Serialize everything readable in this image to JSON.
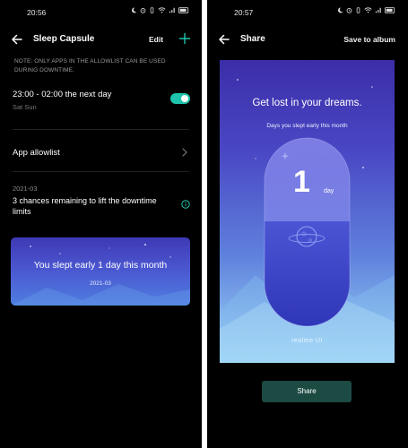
{
  "left_screen": {
    "status_time": "20:56",
    "title": "Sleep Capsule",
    "edit_label": "Edit",
    "notice": "NOTE: ONLY APPS IN THE ALLOWLIST CAN BE USED DURING DOWNTIME.",
    "schedule_time": "23:00 - 02:00 the next day",
    "schedule_days": "Sat Sun",
    "toggle_on": true,
    "allowlist_label": "App allowlist",
    "month": "2021-03",
    "chances_text": "3 chances remaining to lift the downtime limits",
    "summary_text": "You slept early 1 day this month",
    "summary_date": "2021-03"
  },
  "right_screen": {
    "status_time": "20:57",
    "title": "Share",
    "save_label": "Save to album",
    "heading": "Get lost in your dreams.",
    "subheading": "Days you slept early this month",
    "days_count": "1",
    "days_unit": "day",
    "brand": "realme UI",
    "share_button": "Share"
  },
  "colors": {
    "accent": "#1fc3ac",
    "share_button_bg": "#1c4b44",
    "background": "#000000"
  },
  "icons": [
    "back-arrow-icon",
    "add-icon",
    "chevron-right-icon",
    "info-icon",
    "moon-stars-icon",
    "alarm-icon",
    "wifi-icon",
    "signal-icon",
    "battery-icon"
  ]
}
